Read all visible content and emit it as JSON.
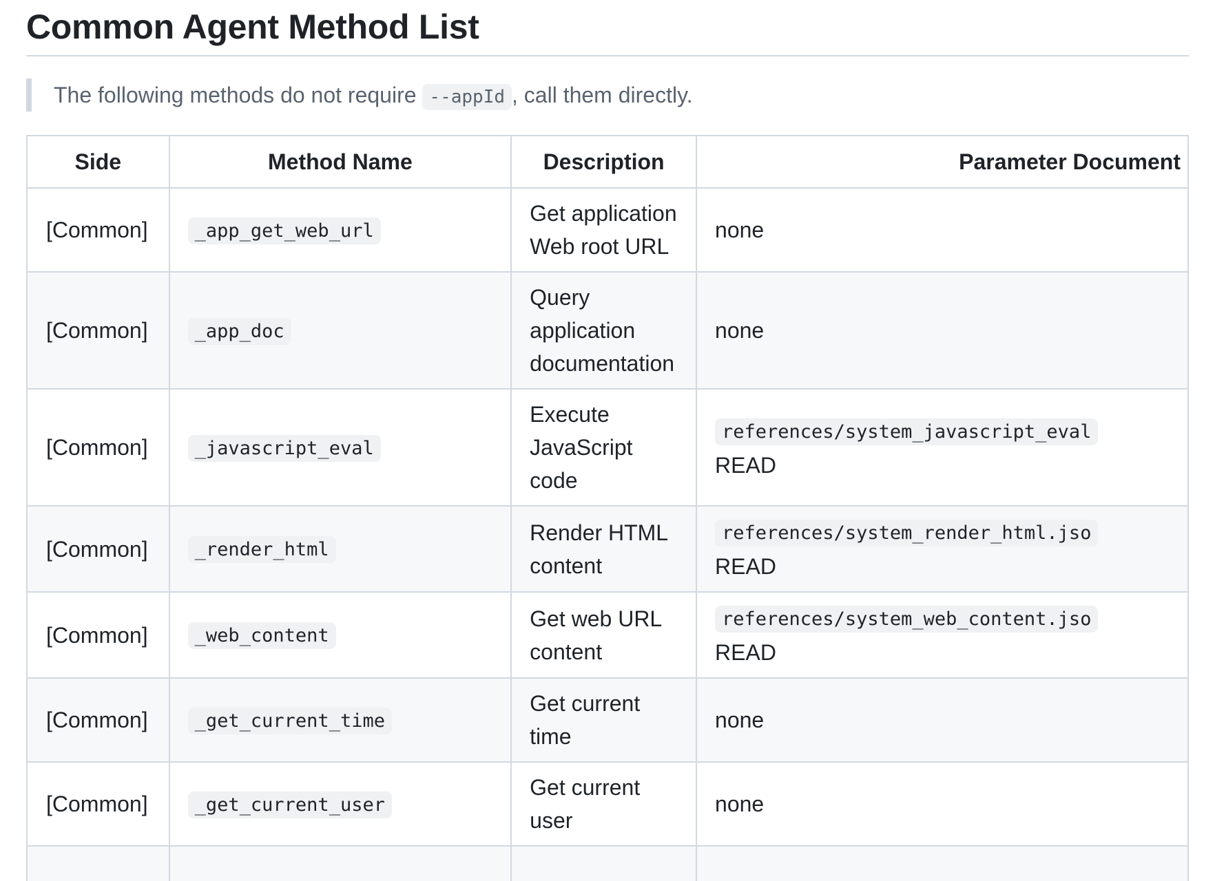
{
  "title": "Common Agent Method List",
  "note": {
    "prefix": "The following methods do not require ",
    "code": "--appId",
    "suffix": ", call them directly."
  },
  "table": {
    "headers": [
      "Side",
      "Method Name",
      "Description",
      "Parameter Document"
    ],
    "rows": [
      {
        "side": "[Common]",
        "method": "_app_get_web_url",
        "description": "Get application Web root URL",
        "param_code": "",
        "param_text": "none"
      },
      {
        "side": "[Common]",
        "method": "_app_doc",
        "description": "Query application documentation",
        "param_code": "",
        "param_text": "none"
      },
      {
        "side": "[Common]",
        "method": "_javascript_eval",
        "description": "Execute JavaScript code",
        "param_code": "references/system_javascript_eval",
        "param_text": "READ"
      },
      {
        "side": "[Common]",
        "method": "_render_html",
        "description": "Render HTML content",
        "param_code": "references/system_render_html.jso",
        "param_text": "READ"
      },
      {
        "side": "[Common]",
        "method": "_web_content",
        "description": "Get web URL content",
        "param_code": "references/system_web_content.jso",
        "param_text": "READ"
      },
      {
        "side": "[Common]",
        "method": "_get_current_time",
        "description": "Get current time",
        "param_code": "",
        "param_text": "none"
      },
      {
        "side": "[Common]",
        "method": "_get_current_user",
        "description": "Get current user",
        "param_code": "",
        "param_text": "none"
      }
    ]
  }
}
